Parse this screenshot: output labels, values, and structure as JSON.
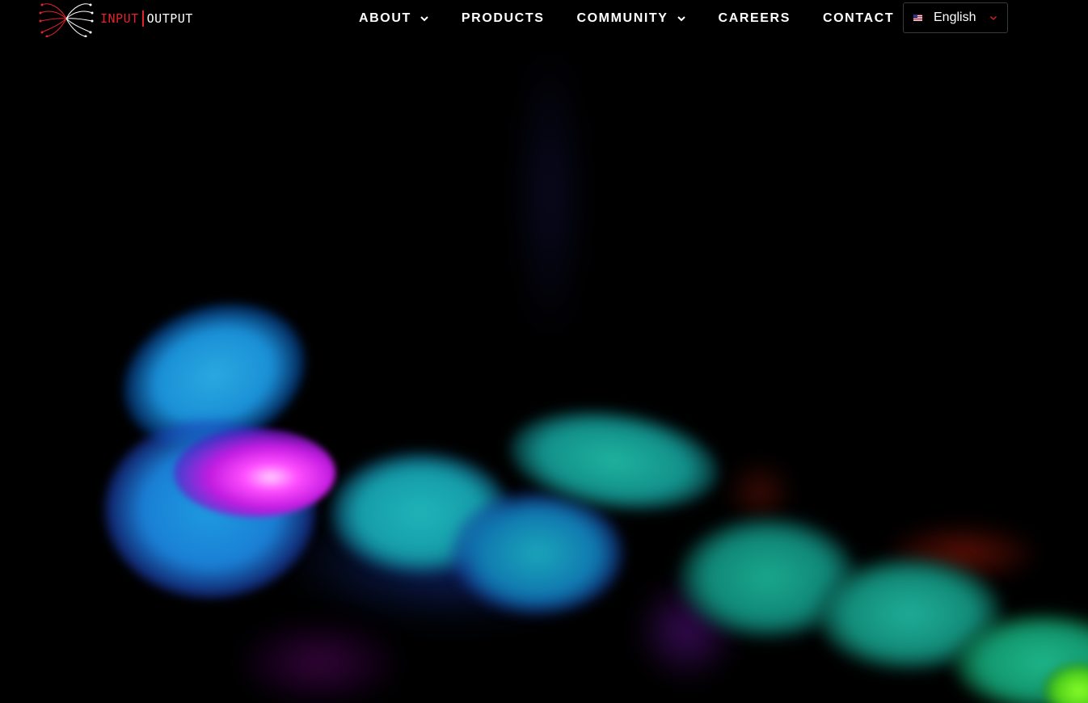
{
  "brand": {
    "input_text": "INPUT",
    "output_text": "OUTPUT",
    "logo_icon": "butterfly-network-logo-icon",
    "input_color": "#e3222b",
    "output_color": "#ffffff"
  },
  "nav": {
    "items": [
      {
        "label": "ABOUT",
        "has_dropdown": true,
        "icon": "chevron-down-icon"
      },
      {
        "label": "PRODUCTS",
        "has_dropdown": false
      },
      {
        "label": "COMMUNITY",
        "has_dropdown": true,
        "icon": "chevron-down-icon"
      },
      {
        "label": "CAREERS",
        "has_dropdown": false
      },
      {
        "label": "CONTACT",
        "has_dropdown": false
      }
    ]
  },
  "language_selector": {
    "selected": "English",
    "flag_icon": "us-flag-icon",
    "chevron_icon": "chevron-down-icon",
    "chevron_color": "#e3222b"
  },
  "hero": {
    "background": "fluid-smoke-animation",
    "colors": [
      "#2aa9e0",
      "#ff4dff",
      "#1fb39e",
      "#4fcf1a"
    ]
  },
  "theme": {
    "page_background": "#000000",
    "nav_text_color": "#ffffff"
  }
}
